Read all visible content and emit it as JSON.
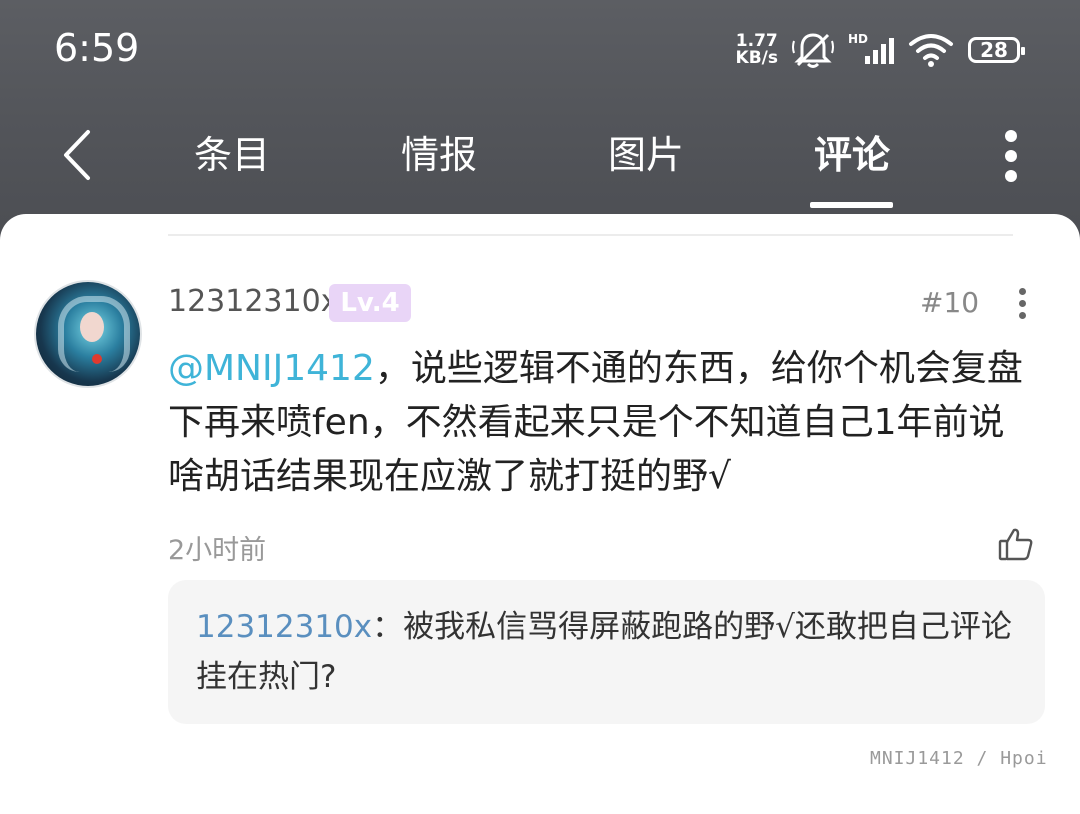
{
  "status_bar": {
    "time": "6:59",
    "net_speed_value": "1.77",
    "net_speed_unit": "KB/s",
    "signal_label": "HD",
    "battery": "28",
    "icons": [
      "mute-bell-icon",
      "signal-icon",
      "wifi-icon",
      "battery-icon"
    ]
  },
  "nav": {
    "back_icon": "chevron-left-icon",
    "tabs": [
      {
        "label": "条目"
      },
      {
        "label": "情报"
      },
      {
        "label": "图片"
      },
      {
        "label": "评论"
      }
    ],
    "active_tab": "评论",
    "more_icon": "vertical-dots-icon"
  },
  "comment": {
    "username": "12312310x",
    "level": "Lv.4",
    "floor": "#10",
    "mention": "@MNIJ1412",
    "text": "，说些逻辑不通的东西，给你个机会复盘下再来喷fen，不然看起来只是个不知道自己1年前说啥胡话结果现在应激了就打挺的野√",
    "time": "2小时前",
    "reply": {
      "user": "12312310x",
      "text": "：被我私信骂得屏蔽跑路的野√还敢把自己评论挂在热门?"
    }
  },
  "watermark": "MNIJ1412 / Hpoi",
  "colors": {
    "header_bg": "#55575c",
    "mention": "#3fb4d8",
    "reply_user": "#5a8fbf",
    "level_badge": "#e9d5f7"
  }
}
